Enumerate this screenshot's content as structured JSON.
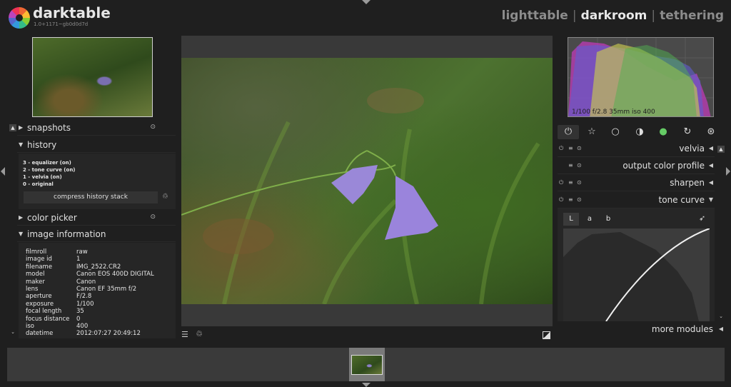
{
  "app": {
    "name": "darktable",
    "version": "1.0+1171~gb0d0d7d"
  },
  "views": {
    "lighttable": "lighttable",
    "darkroom": "darkroom",
    "tethering": "tethering",
    "separator": "|"
  },
  "left_panel": {
    "modules": {
      "snapshots": "snapshots",
      "history": "history",
      "color_picker": "color picker",
      "image_information": "image information"
    },
    "history_items": [
      "3 - equalizer (on)",
      "2 - tone curve (on)",
      "1 - velvia (on)",
      "0 - original"
    ],
    "compress_button": "compress history stack",
    "image_info": [
      {
        "key": "filmroll",
        "value": "raw"
      },
      {
        "key": "image id",
        "value": "1"
      },
      {
        "key": "filename",
        "value": "IMG_2522.CR2"
      },
      {
        "key": "model",
        "value": "Canon EOS 400D DIGITAL"
      },
      {
        "key": "maker",
        "value": "Canon"
      },
      {
        "key": "lens",
        "value": "Canon EF 35mm f/2"
      },
      {
        "key": "aperture",
        "value": "F/2.8"
      },
      {
        "key": "exposure",
        "value": "1/100"
      },
      {
        "key": "focal length",
        "value": "35"
      },
      {
        "key": "focus distance",
        "value": "0"
      },
      {
        "key": "iso",
        "value": "400"
      },
      {
        "key": "datetime",
        "value": "2012:07:27 20:49:12"
      }
    ]
  },
  "right_panel": {
    "histogram_readout": "1/100 f/2.8 35mm iso 400",
    "modules": {
      "velvia": "velvia",
      "output_color_profile": "output color profile",
      "sharpen": "sharpen",
      "tone_curve": "tone curve"
    },
    "curve_tabs": {
      "L": "L",
      "a": "a",
      "b": "b"
    },
    "more_modules": "more modules"
  },
  "icons": {
    "power": "power-icon",
    "favorite": "star-icon",
    "basic": "circle-icon",
    "tone": "half-circle-icon",
    "color": "color-circle-icon",
    "correct": "loop-icon",
    "effect": "effect-icon"
  },
  "colors": {
    "background": "#1f1f1f",
    "panel": "#262626",
    "center": "#393939",
    "text": "#e0e0e0",
    "active_view": "#e8e8e8",
    "inactive_view": "#8c8c8c"
  }
}
